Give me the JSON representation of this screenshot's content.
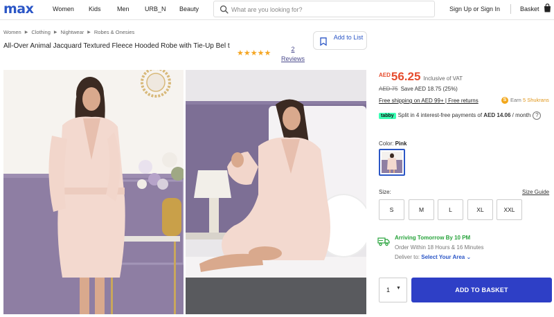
{
  "header": {
    "logo": "max",
    "nav": [
      {
        "label": "Women"
      },
      {
        "label": "Kids"
      },
      {
        "label": "Men"
      },
      {
        "label": "URB_N"
      },
      {
        "label": "Beauty"
      }
    ],
    "search_placeholder": "What are you looking for?",
    "signin_label": "Sign Up or Sign In",
    "basket_label": "Basket"
  },
  "breadcrumb": [
    "Women",
    "Clothing",
    "Nightwear",
    "Robes & Onesies"
  ],
  "product": {
    "title": "All-Over Animal Jacquard Textured Fleece Hooded Robe with Tie-Up Bel t",
    "stars": "★★★★★",
    "rating_value": 5,
    "review_count": "2",
    "reviews_label": "Reviews",
    "add_to_list_label": "Add to List"
  },
  "pricing": {
    "currency": "AED",
    "price": "56.25",
    "vat_note": "Inclusive of VAT",
    "was_price": "AED 75",
    "save_text": "Save AED 18.75 (25%)",
    "shipping_text": "Free shipping on AED 99+ | Free returns",
    "shukrans_prefix": "Earn",
    "shukrans_value": "5 Shukrans",
    "tabby_badge": "tabby",
    "tabby_text": "Split in 4 interest-free payments of",
    "tabby_amount": "AED 14.06",
    "tabby_suffix": "/ month",
    "help_mark": "?"
  },
  "color": {
    "label": "Color:",
    "value": "Pink"
  },
  "size": {
    "label": "Size:",
    "guide_label": "Size Guide",
    "options": [
      "S",
      "M",
      "L",
      "XL",
      "XXL"
    ]
  },
  "delivery": {
    "arriving": "Arriving Tomorrow By 10 PM",
    "order_within": "Order Within 18 Hours & 16 Minutes",
    "deliver_to_label": "Deliver to:",
    "area_label": "Select Your Area"
  },
  "purchase": {
    "quantity": "1",
    "add_label": "ADD TO BASKET"
  },
  "colors": {
    "brand_blue": "#2b56c6",
    "price_red": "#e64c2e",
    "delivery_green": "#27a33b",
    "button_blue": "#2e3fc6",
    "star_gold": "#f5a623"
  }
}
